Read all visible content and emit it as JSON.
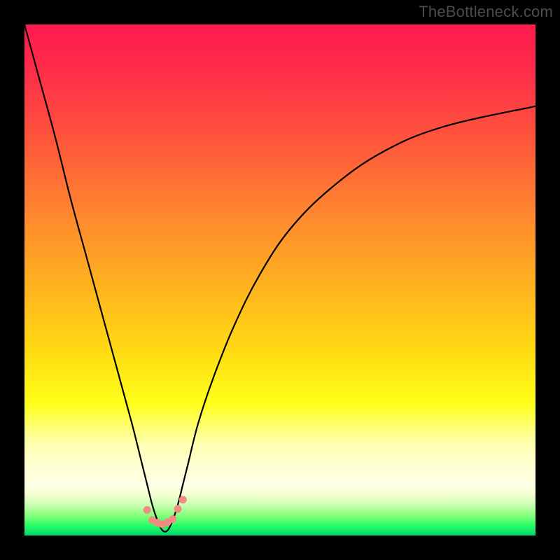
{
  "watermark": "TheBottleneck.com",
  "colors": {
    "page_bg": "#000000",
    "watermark_text": "#4c4c4c",
    "curve_stroke": "#000000",
    "dot_fill": "#f28b82"
  },
  "chart_data": {
    "type": "line",
    "title": "",
    "xlabel": "",
    "ylabel": "",
    "xlim": [
      0,
      100
    ],
    "ylim": [
      0,
      100
    ],
    "grid": false,
    "legend": false,
    "note": "x and y are in percent of plot area; y=0 is bottom, y=100 is top; minimum of curve near x≈27",
    "series": [
      {
        "name": "bottleneck-curve",
        "x": [
          0,
          3,
          6,
          9,
          12,
          15,
          18,
          21,
          23,
          24,
          25,
          26,
          27,
          28,
          29,
          30,
          31,
          32,
          34,
          37,
          41,
          46,
          52,
          60,
          70,
          82,
          100
        ],
        "y": [
          100,
          89,
          78,
          66,
          55,
          44,
          33,
          22,
          14,
          10,
          6,
          3,
          1,
          1,
          3,
          6,
          10,
          14,
          22,
          31,
          41,
          51,
          60,
          68,
          75,
          80,
          84
        ]
      }
    ],
    "dots": {
      "name": "highlight-dots",
      "points": [
        {
          "x": 24.0,
          "y": 5.0
        },
        {
          "x": 25.0,
          "y": 3.0
        },
        {
          "x": 26.0,
          "y": 2.5
        },
        {
          "x": 27.0,
          "y": 2.2
        },
        {
          "x": 28.0,
          "y": 2.6
        },
        {
          "x": 29.0,
          "y": 3.2
        },
        {
          "x": 30.0,
          "y": 5.2
        },
        {
          "x": 31.0,
          "y": 7.0
        }
      ]
    }
  }
}
